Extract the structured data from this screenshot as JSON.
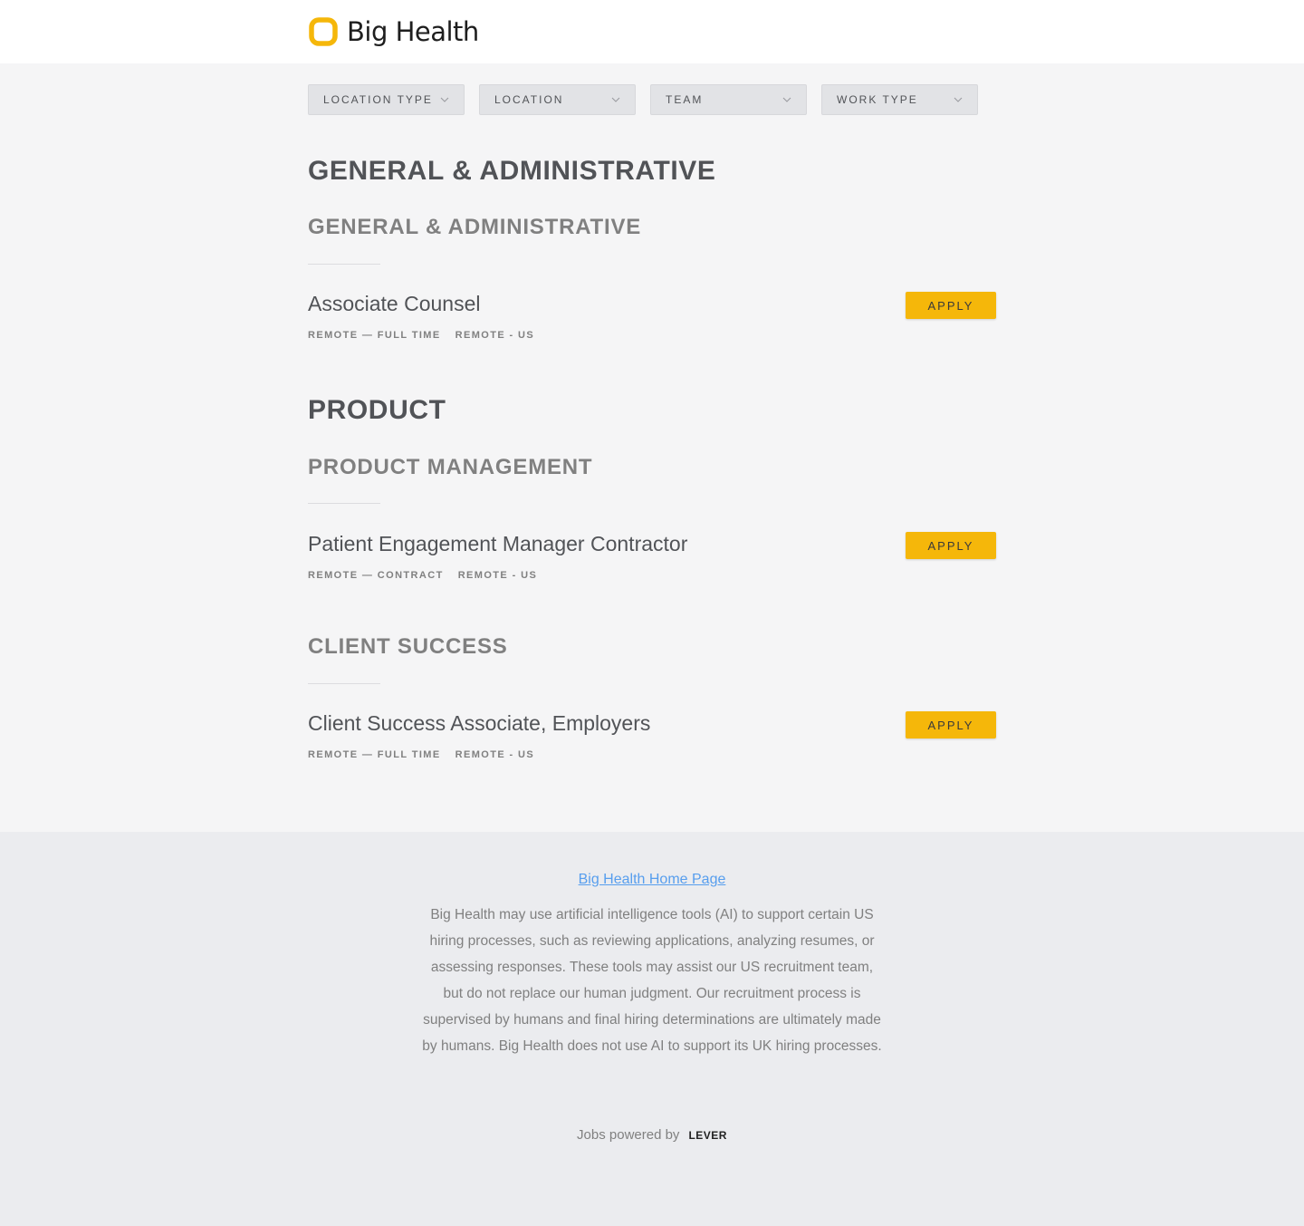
{
  "header": {
    "brand_name": "Big Health",
    "brand_color": "#F5B70A"
  },
  "filters": [
    {
      "label": "LOCATION TYPE",
      "icon": "chevron-down-icon"
    },
    {
      "label": "LOCATION",
      "icon": "chevron-down-icon"
    },
    {
      "label": "TEAM",
      "icon": "chevron-down-icon"
    },
    {
      "label": "WORK TYPE",
      "icon": "chevron-down-icon"
    }
  ],
  "groups": [
    {
      "title": "GENERAL & ADMINISTRATIVE",
      "teams": [
        {
          "title": "GENERAL & ADMINISTRATIVE",
          "postings": [
            {
              "title": "Associate Counsel",
              "commitment": "REMOTE — FULL TIME",
              "location": "REMOTE - US",
              "apply_label": "APPLY"
            }
          ]
        }
      ]
    },
    {
      "title": "PRODUCT",
      "teams": [
        {
          "title": "PRODUCT MANAGEMENT",
          "postings": [
            {
              "title": "Patient Engagement Manager Contractor",
              "commitment": "REMOTE — CONTRACT",
              "location": "REMOTE - US",
              "apply_label": "APPLY"
            }
          ]
        },
        {
          "title": "CLIENT SUCCESS",
          "postings": [
            {
              "title": "Client Success Associate, Employers",
              "commitment": "REMOTE — FULL TIME",
              "location": "REMOTE - US",
              "apply_label": "APPLY"
            }
          ]
        }
      ]
    }
  ],
  "footer": {
    "home_link": "Big Health Home Page",
    "disclaimer": "Big Health may use artificial intelligence tools (AI) to support certain US hiring processes, such as reviewing applications, analyzing resumes, or assessing responses. These tools may assist our US recruitment team, but do not replace our human judgment. Our recruitment process is supervised by humans and final hiring determinations are ultimately made by humans. Big Health does not use AI to support its UK hiring processes.",
    "powered_by": "Jobs powered by",
    "lever_logo": "LEVER",
    "link_color": "#579EEE"
  }
}
